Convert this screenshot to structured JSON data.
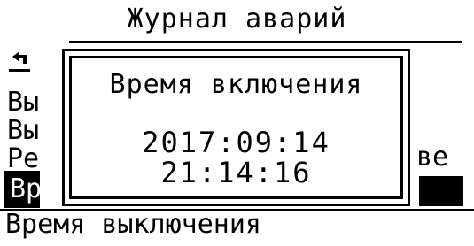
{
  "screen": {
    "title": "Журнал аварий",
    "menu_items": [
      {
        "label": "Вы"
      },
      {
        "label": "Вы"
      },
      {
        "label": "Ре"
      },
      {
        "label": "Вр"
      }
    ],
    "right_fragment": "ве",
    "bottom_item": "Время выключения"
  },
  "dialog": {
    "title": "Время включения",
    "date": "2017:09:14",
    "time": "21:14:16"
  },
  "colors": {
    "foreground": "#000000",
    "background": "#ffffff"
  },
  "icons": {
    "back": "back-arrow-icon"
  }
}
